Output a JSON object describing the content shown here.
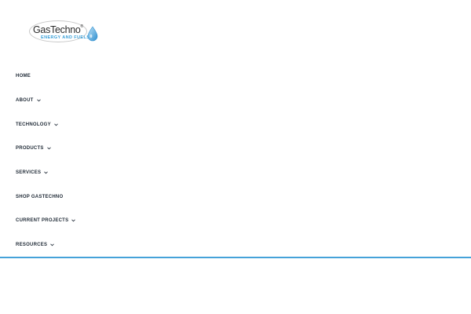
{
  "brand": {
    "name": "GasTechno",
    "registered_mark": "®",
    "tagline": "ENERGY AND FUELS",
    "accent_color": "#46a2d9",
    "icon": "water-drop-icon"
  },
  "nav": {
    "items": [
      {
        "label": "HOME",
        "has_dropdown": false
      },
      {
        "label": "ABOUT",
        "has_dropdown": true
      },
      {
        "label": "TECHNOLOGY",
        "has_dropdown": true
      },
      {
        "label": "PRODUCTS",
        "has_dropdown": true
      },
      {
        "label": "SERVICES",
        "has_dropdown": true
      },
      {
        "label": "SHOP GASTECHNO",
        "has_dropdown": false
      },
      {
        "label": "CURRENT PROJECTS",
        "has_dropdown": true
      },
      {
        "label": "RESOURCES",
        "has_dropdown": true
      }
    ],
    "dropdown_icon": "chevron-down-icon"
  }
}
